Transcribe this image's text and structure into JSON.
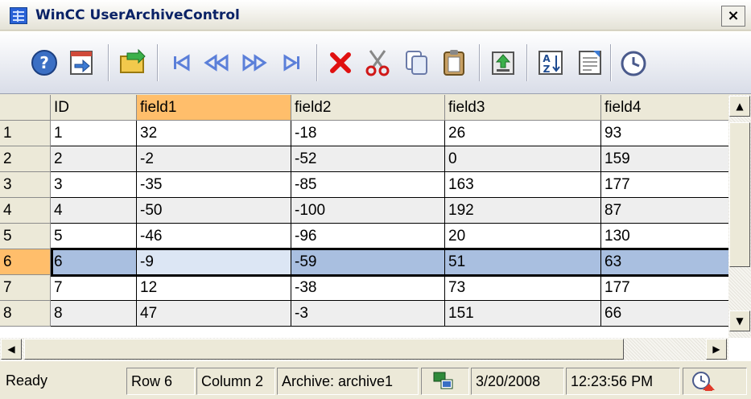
{
  "window": {
    "title": "WinCC UserArchiveControl",
    "close_glyph": "×"
  },
  "toolbar": {
    "buttons": [
      {
        "name": "help-icon"
      },
      {
        "name": "select-archive-icon"
      },
      {
        "name": "open-archive-icon"
      },
      {
        "name": "first-record-icon"
      },
      {
        "name": "previous-record-icon"
      },
      {
        "name": "next-record-icon"
      },
      {
        "name": "last-record-icon"
      },
      {
        "name": "delete-icon"
      },
      {
        "name": "cut-icon"
      },
      {
        "name": "copy-icon"
      },
      {
        "name": "paste-icon"
      },
      {
        "name": "export-icon"
      },
      {
        "name": "sort-icon"
      },
      {
        "name": "import-icon"
      },
      {
        "name": "time-base-icon"
      }
    ]
  },
  "grid": {
    "columns": [
      "ID",
      "field1",
      "field2",
      "field3",
      "field4"
    ],
    "active_column": 1,
    "rows": [
      {
        "label": "1",
        "cells": [
          "1",
          "32",
          "-18",
          "26",
          "93"
        ]
      },
      {
        "label": "2",
        "cells": [
          "2",
          "-2",
          "-52",
          "0",
          "159"
        ]
      },
      {
        "label": "3",
        "cells": [
          "3",
          "-35",
          "-85",
          "163",
          "177"
        ]
      },
      {
        "label": "4",
        "cells": [
          "4",
          "-50",
          "-100",
          "192",
          "87"
        ]
      },
      {
        "label": "5",
        "cells": [
          "5",
          "-46",
          "-96",
          "20",
          "130"
        ]
      },
      {
        "label": "6",
        "cells": [
          "6",
          "-9",
          "-59",
          "51",
          "63"
        ]
      },
      {
        "label": "7",
        "cells": [
          "7",
          "12",
          "-38",
          "73",
          "177"
        ]
      },
      {
        "label": "8",
        "cells": [
          "8",
          "47",
          "-3",
          "151",
          "66"
        ]
      }
    ],
    "selected_row": 5
  },
  "scrollbars": {
    "up": "▲",
    "down": "▼",
    "left": "◀",
    "right": "▶"
  },
  "status": {
    "state": "Ready",
    "row": "Row 6",
    "column": "Column 2",
    "archive": "Archive: archive1",
    "date": "3/20/2008",
    "time": "12:23:56 PM"
  },
  "colors": {
    "active_header": "#ffbe6b",
    "selected_row": "#a9bfe0",
    "selected_cell": "#dce6f4",
    "alt_row": "#eeeeee",
    "title_text": "#0a2266"
  }
}
